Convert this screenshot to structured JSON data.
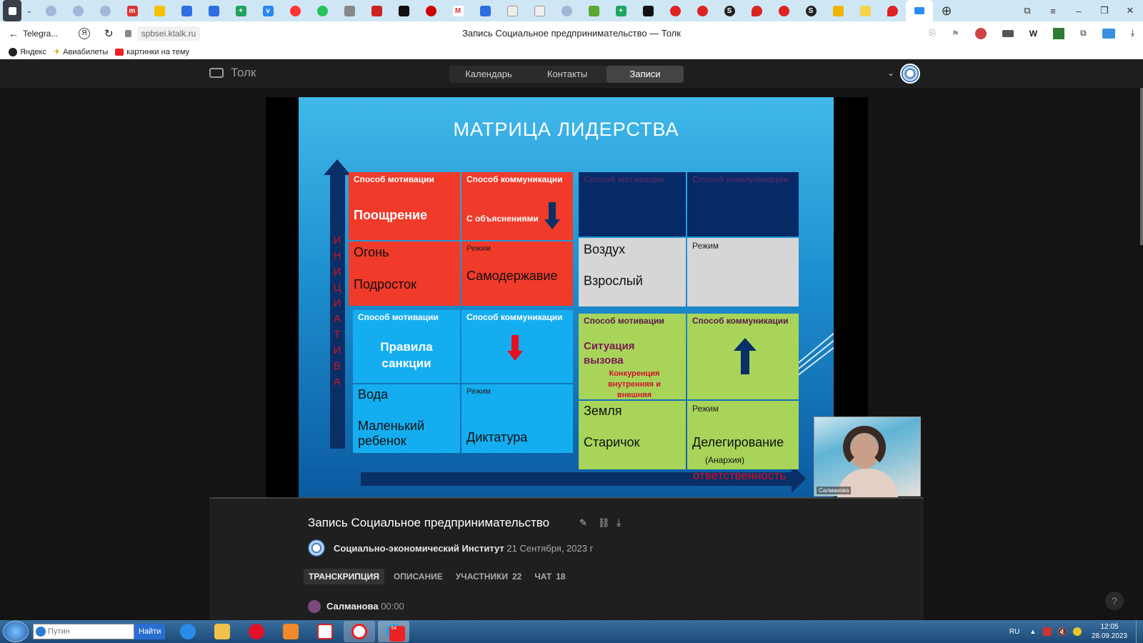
{
  "browser": {
    "address": "spbsei.ktalk.ru",
    "page_title": "Запись Социальное предпринимательство — Толк",
    "back_tab_label": "Telegra...",
    "bookmarks": [
      "Яндекс",
      "Авиабилеты",
      "картинки на тему"
    ]
  },
  "app": {
    "logo": "Толк",
    "nav": [
      "Календарь",
      "Контакты",
      "Записи"
    ],
    "active_nav": "Записи"
  },
  "slide": {
    "title": "МАТРИЦА ЛИДЕРСТВА",
    "vertical_label": "И Н И Ц И А Т И В А",
    "horizontal_label": "ответственность",
    "label_mot": "Способ мотивации",
    "label_com": "Способ коммуникации",
    "label_mode": "Режим",
    "red": {
      "motivation": "Поощрение",
      "communication": "С объяснениями",
      "element": "Огонь",
      "age": "Подросток",
      "mode": "Самодержавие"
    },
    "blue": {
      "motivation": "Правила санкции",
      "element": "Вода",
      "age": "Маленький ребенок",
      "mode": "Диктатура"
    },
    "gray": {
      "element": "Воздух",
      "age": "Взрослый"
    },
    "green": {
      "motivation": "Ситуация вызова",
      "motivation_sub": "Конкуренция внутренняя и внешняя",
      "element": "Земля",
      "age": "Старичок",
      "mode": "Делегирование",
      "mode_sub": "(Анархия)"
    }
  },
  "pip_name": "Салманова",
  "playback_progress": 0.0,
  "recording": {
    "title": "Запись Социальное предпринимательство",
    "org": "Социально-экономический Институт",
    "date": "21 Сентября, 2023 г",
    "tabs": [
      "ТРАНСКРИПЦИЯ",
      "ОПИСАНИЕ",
      "УЧАСТНИКИ",
      "ЧАТ"
    ],
    "participants_count": "22",
    "chat_count": "18",
    "speaker": "Салманова",
    "speaker_time": "00:00"
  },
  "taskbar": {
    "search_value": "Путин",
    "search_button": "Найти",
    "lang": "RU",
    "time": "12:05",
    "date": "28.09.2023",
    "telegram_badge": "54"
  },
  "colors": {
    "accent": "#2a8cf0",
    "red_cell": "#f03a2a",
    "blue_cell": "#14aef0",
    "gray_cell": "#d6d6d6",
    "green_cell": "#a8d45a",
    "navy_cell": "#062a66"
  }
}
